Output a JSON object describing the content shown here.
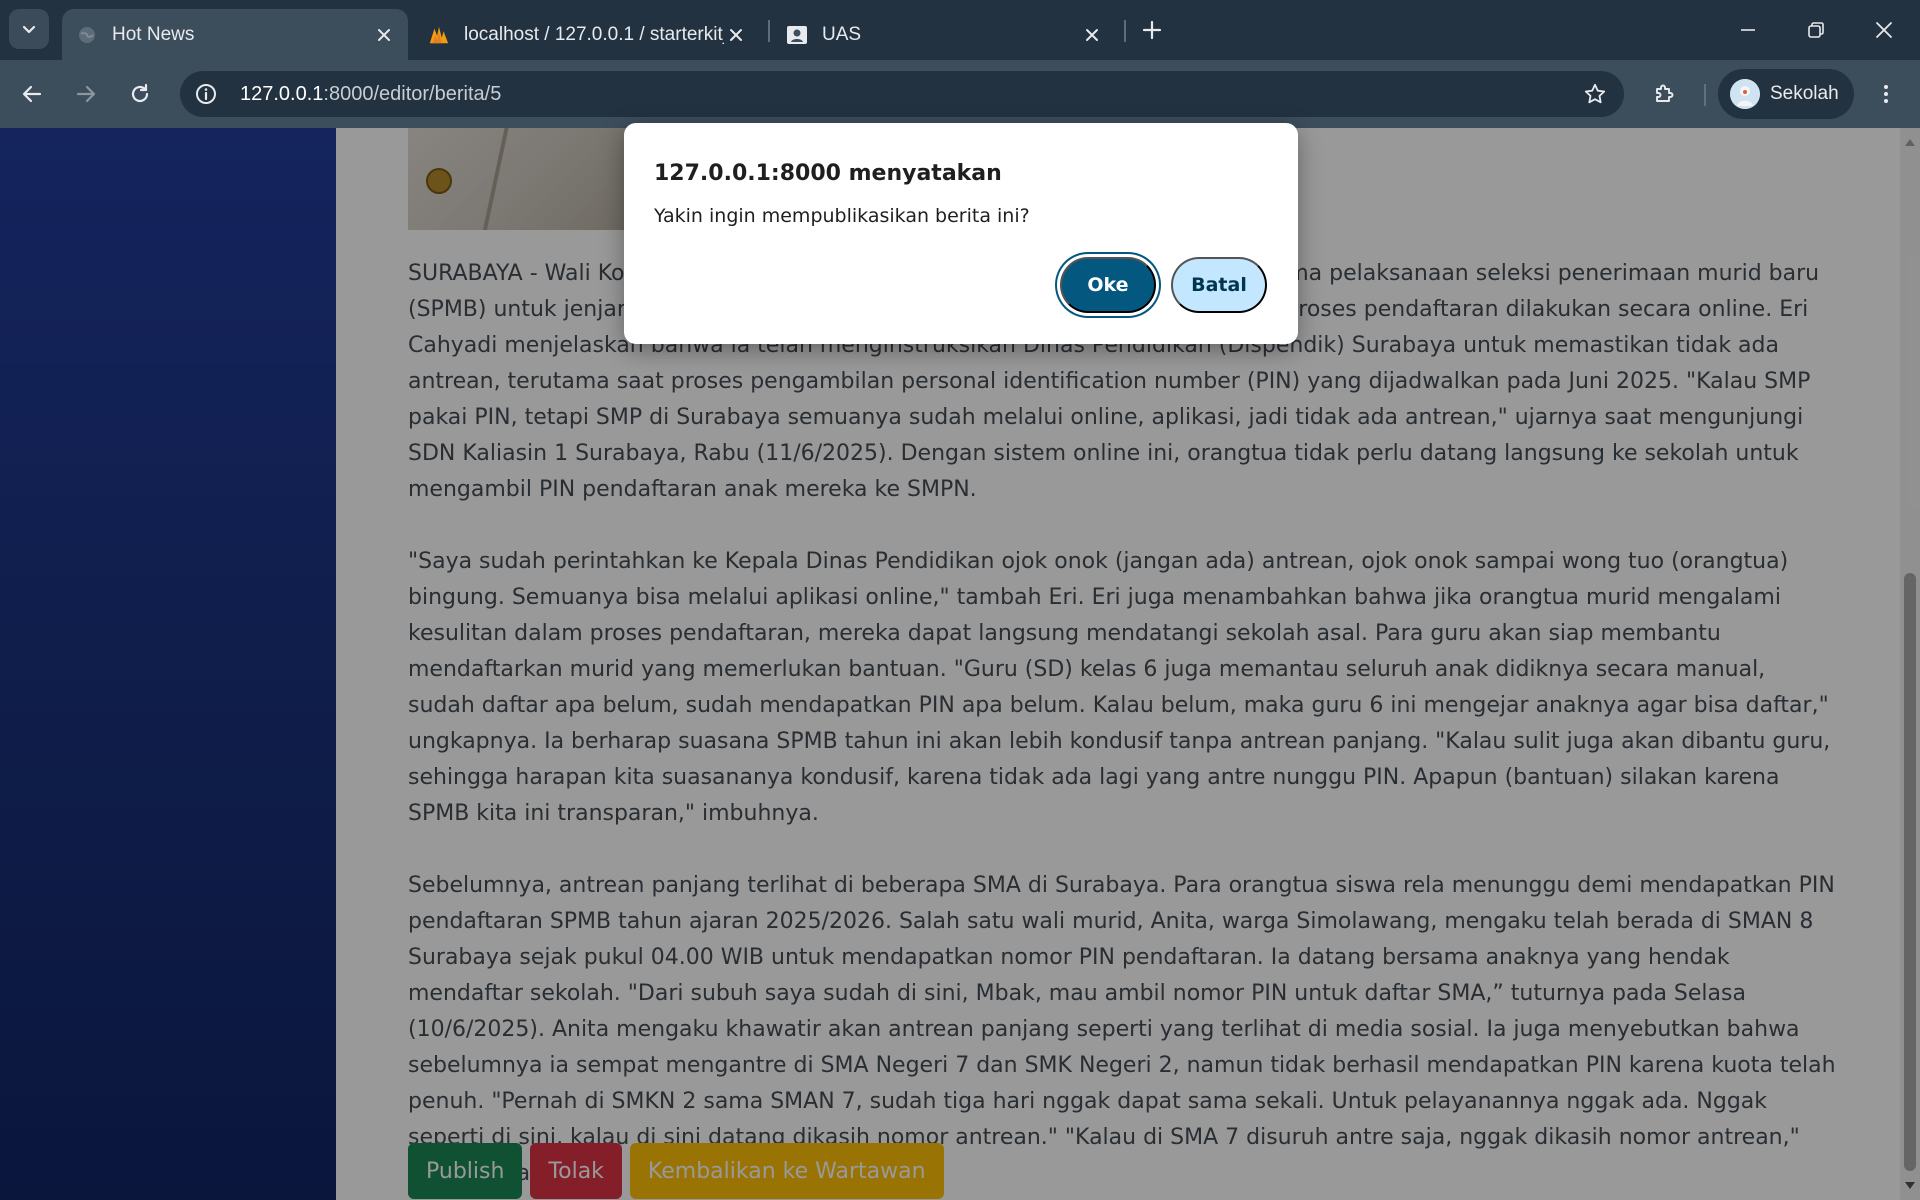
{
  "browser": {
    "tabs": [
      {
        "title": "Hot News",
        "active": true,
        "favicon": "globe-icon"
      },
      {
        "title": "localhost / 127.0.0.1 / starterkit_",
        "active": false,
        "favicon": "phpmyadmin-icon"
      },
      {
        "title": "UAS",
        "active": false,
        "favicon": "contact-card-icon"
      }
    ],
    "url": {
      "host": "127.0.0.1",
      "path": ":8000/editor/berita/5"
    },
    "profile_name": "Sekolah"
  },
  "dialog": {
    "title": "127.0.0.1:8000 menyatakan",
    "message": "Yakin ingin mempublikasikan berita ini?",
    "ok_label": "Oke",
    "cancel_label": "Batal"
  },
  "article": {
    "paragraphs": [
      "SURABAYA - Wali Kota Surabaya Eri Cahyadi memastikan tidak ada antrean selama pelaksanaan seleksi penerimaan murid baru (SPMB) untuk jenjang SMP tahun ajaran 2025/2026. Hal ini disebabkan seluruh proses pendaftaran dilakukan secara online. Eri Cahyadi menjelaskan bahwa ia telah menginstruksikan Dinas Pendidikan (Dispendik) Surabaya untuk memastikan tidak ada antrean, terutama saat proses pengambilan personal identification number (PIN) yang dijadwalkan pada Juni 2025. \"Kalau SMP pakai PIN, tetapi SMP di Surabaya semuanya sudah melalui online, aplikasi, jadi tidak ada antrean,\" ujarnya saat mengunjungi SDN Kaliasin 1 Surabaya, Rabu (11/6/2025). Dengan sistem online ini, orangtua tidak perlu datang langsung ke sekolah untuk mengambil PIN pendaftaran anak mereka ke SMPN.",
      "\"Saya sudah perintahkan ke Kepala Dinas Pendidikan ojok onok (jangan ada) antrean, ojok onok sampai wong tuo (orangtua) bingung. Semuanya bisa melalui aplikasi online,\" tambah Eri. Eri juga menambahkan bahwa jika orangtua murid mengalami kesulitan dalam proses pendaftaran, mereka dapat langsung mendatangi sekolah asal. Para guru akan siap membantu mendaftarkan murid yang memerlukan bantuan. \"Guru (SD) kelas 6 juga memantau seluruh anak didiknya secara manual, sudah daftar apa belum, sudah mendapatkan PIN apa belum. Kalau belum, maka guru 6 ini mengejar anaknya agar bisa daftar,\" ungkapnya. Ia berharap suasana SPMB tahun ini akan lebih kondusif tanpa antrean panjang. \"Kalau sulit juga akan dibantu guru, sehingga harapan kita suasananya kondusif, karena tidak ada lagi yang antre nunggu PIN. Apapun (bantuan) silakan karena SPMB kita ini transparan,\" imbuhnya.",
      "Sebelumnya, antrean panjang terlihat di beberapa SMA di Surabaya. Para orangtua siswa rela menunggu demi mendapatkan PIN pendaftaran SPMB tahun ajaran 2025/2026. Salah satu wali murid, Anita, warga Simolawang, mengaku telah berada di SMAN 8 Surabaya sejak pukul 04.00 WIB untuk mendapatkan nomor PIN pendaftaran. Ia datang bersama anaknya yang hendak mendaftar sekolah. \"Dari subuh saya sudah di sini, Mbak, mau ambil nomor PIN untuk daftar SMA,” tuturnya pada Selasa (10/6/2025). Anita mengaku khawatir akan antrean panjang seperti yang terlihat di media sosial. Ia juga menyebutkan bahwa sebelumnya ia sempat mengantre di SMA Negeri 7 dan SMK Negeri 2, namun tidak berhasil mendapatkan PIN karena kuota telah penuh. \"Pernah di SMKN 2 sama SMAN 7, sudah tiga hari nggak dapat sama sekali. Untuk pelayanannya nggak ada. Nggak seperti di sini, kalau di sini datang dikasih nomor antrean.\" \"Kalau di SMA 7 disuruh antre saja, nggak dikasih nomor antrean,\" ungkapnya."
    ]
  },
  "actions": {
    "publish_label": "Publish",
    "reject_label": "Tolak",
    "return_label": "Kembalikan ke Wartawan"
  },
  "colors": {
    "sidebar": "#1b3380",
    "publish": "#198754",
    "reject": "#dc3545",
    "return": "#ffc107",
    "dialog_ok": "#04587f",
    "dialog_cancel": "#c2e7ff"
  }
}
